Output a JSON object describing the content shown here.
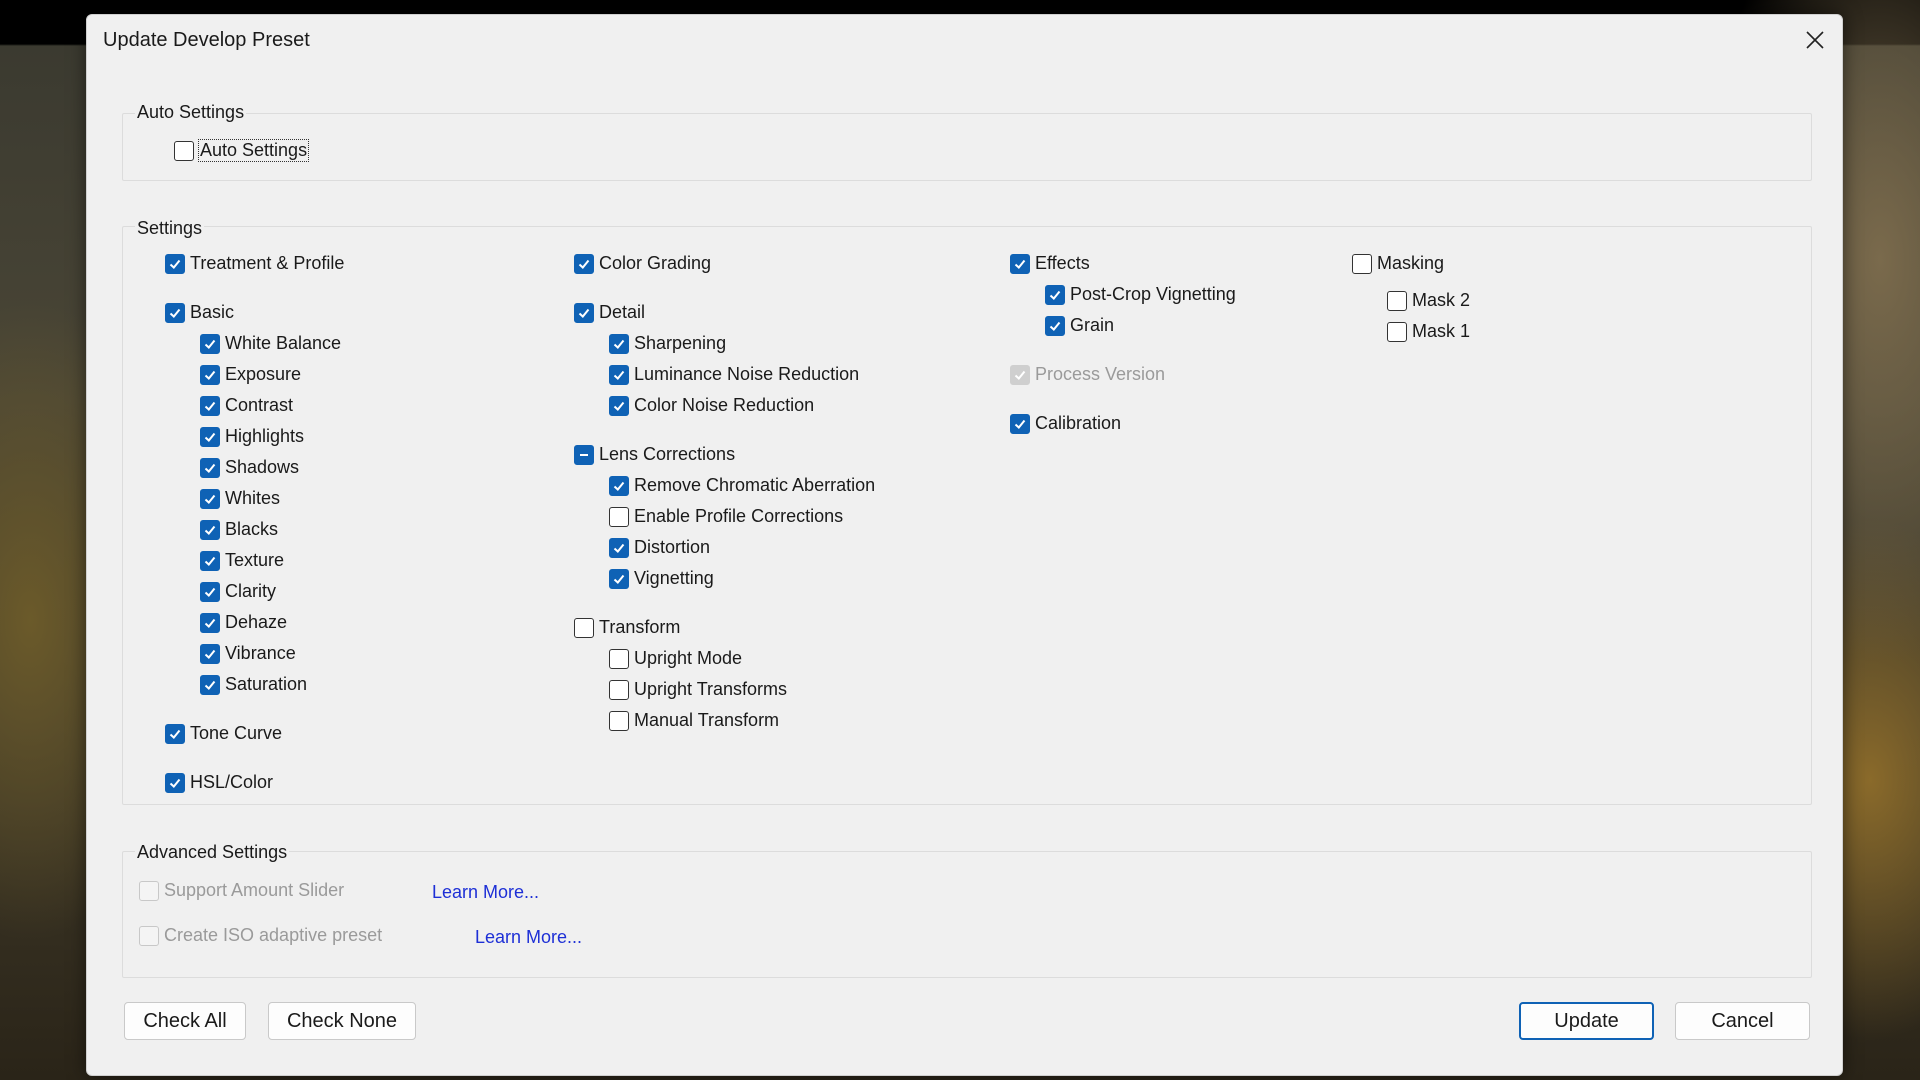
{
  "dialog": {
    "title": "Update Develop Preset"
  },
  "auto_settings": {
    "legend": "Auto Settings",
    "checkbox": {
      "label": "Auto Settings",
      "checked": false
    }
  },
  "settings": {
    "legend": "Settings",
    "col1": {
      "treatment_profile": "Treatment & Profile",
      "basic": "Basic",
      "white_balance": "White Balance",
      "exposure": "Exposure",
      "contrast": "Contrast",
      "highlights": "Highlights",
      "shadows": "Shadows",
      "whites": "Whites",
      "blacks": "Blacks",
      "texture": "Texture",
      "clarity": "Clarity",
      "dehaze": "Dehaze",
      "vibrance": "Vibrance",
      "saturation": "Saturation",
      "tone_curve": "Tone Curve",
      "hsl_color": "HSL/Color"
    },
    "col2": {
      "color_grading": "Color Grading",
      "detail": "Detail",
      "sharpening": "Sharpening",
      "luminance_noise": "Luminance Noise Reduction",
      "color_noise": "Color Noise Reduction",
      "lens_corrections": "Lens Corrections",
      "remove_chromatic": "Remove Chromatic Aberration",
      "enable_profile": "Enable Profile Corrections",
      "distortion": "Distortion",
      "vignetting": "Vignetting",
      "transform": "Transform",
      "upright_mode": "Upright Mode",
      "upright_transforms": "Upright Transforms",
      "manual_transform": "Manual Transform"
    },
    "col3": {
      "effects": "Effects",
      "post_crop_vignetting": "Post-Crop Vignetting",
      "grain": "Grain",
      "process_version": "Process Version",
      "calibration": "Calibration"
    },
    "col4": {
      "masking": "Masking",
      "mask2": "Mask 2",
      "mask1": "Mask 1"
    }
  },
  "advanced": {
    "legend": "Advanced Settings",
    "support_amount_slider": "Support Amount Slider",
    "iso_adaptive": "Create ISO adaptive preset",
    "learn_more_1": "Learn More...",
    "learn_more_2": "Learn More..."
  },
  "buttons": {
    "check_all": "Check All",
    "check_none": "Check None",
    "update": "Update",
    "cancel": "Cancel"
  },
  "colors": {
    "checkbox_accent": "#0f62b5",
    "link": "#1d2fd6",
    "dialog_bg": "#f0f0f0"
  }
}
